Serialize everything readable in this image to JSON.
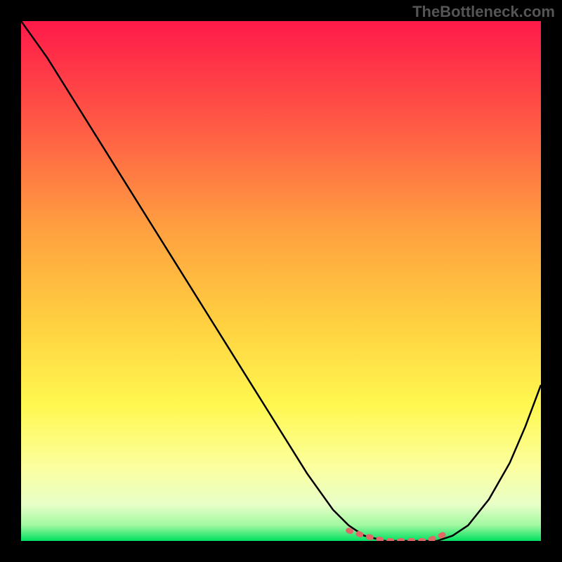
{
  "watermark": "TheBottleneck.com",
  "chart_data": {
    "type": "line",
    "title": "",
    "xlabel": "",
    "ylabel": "",
    "xlim": [
      0,
      100
    ],
    "ylim": [
      0,
      100
    ],
    "grid": false,
    "background_gradient": {
      "top": "#ff1a4a",
      "mid_upper": "#ff8040",
      "mid": "#ffd040",
      "mid_lower": "#fff850",
      "lower": "#f8ffb0",
      "bottom": "#00e060"
    },
    "series": [
      {
        "name": "curve",
        "color": "#000000",
        "x": [
          0,
          5,
          10,
          15,
          20,
          25,
          30,
          35,
          40,
          45,
          50,
          55,
          60,
          63,
          66,
          70,
          74,
          78,
          80,
          83,
          86,
          90,
          94,
          97,
          100
        ],
        "y": [
          100,
          93,
          85,
          77,
          69,
          61,
          53,
          45,
          37,
          29,
          21,
          13,
          6,
          3,
          1,
          0,
          0,
          0,
          0,
          1,
          3,
          8,
          15,
          22,
          30
        ]
      }
    ],
    "highlight_segment": {
      "name": "bottom-dashed-pink",
      "color": "#e06868",
      "style": "dashed",
      "x": [
        63,
        66,
        70,
        74,
        78,
        80,
        82
      ],
      "y": [
        2,
        1,
        0,
        0,
        0,
        0.7,
        1.5
      ]
    }
  }
}
